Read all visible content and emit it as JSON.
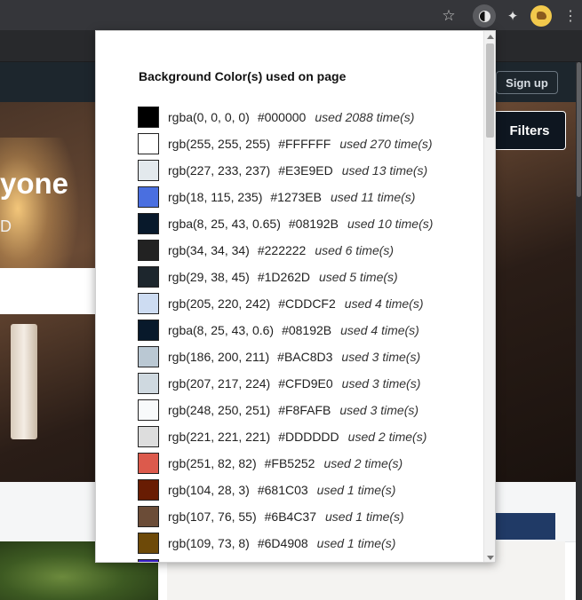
{
  "browser": {
    "toolbar_icons": [
      "star-icon",
      "contrast-icon",
      "puzzle-icon",
      "avatar",
      "kebab-menu-icon"
    ],
    "star_glyph": "☆",
    "puzzle_glyph": "✦",
    "menu_glyph": "⋮"
  },
  "site": {
    "signup_label": "Sign up",
    "filters_label": "Filters",
    "hero_heading": "yone",
    "hero_sub": "D"
  },
  "popup": {
    "title": "Background Color(s) used on page",
    "colors": [
      {
        "rgb": "rgba(0, 0, 0, 0)",
        "hex": "#000000",
        "used": "used 2088 time(s)",
        "swatch": "#000000"
      },
      {
        "rgb": "rgb(255, 255, 255)",
        "hex": "#FFFFFF",
        "used": "used 270 time(s)",
        "swatch": "#FFFFFF"
      },
      {
        "rgb": "rgb(227, 233, 237)",
        "hex": "#E3E9ED",
        "used": "used 13 time(s)",
        "swatch": "#E3E9ED"
      },
      {
        "rgb": "rgb(18, 115, 235)",
        "hex": "#1273EB",
        "used": "used 11 time(s)",
        "swatch": "#4a6fe0"
      },
      {
        "rgb": "rgba(8, 25, 43, 0.65)",
        "hex": "#08192B",
        "used": "used 10 time(s)",
        "swatch": "#08192B"
      },
      {
        "rgb": "rgb(34, 34, 34)",
        "hex": "#222222",
        "used": "used 6 time(s)",
        "swatch": "#222222"
      },
      {
        "rgb": "rgb(29, 38, 45)",
        "hex": "#1D262D",
        "used": "used 5 time(s)",
        "swatch": "#1D262D"
      },
      {
        "rgb": "rgb(205, 220, 242)",
        "hex": "#CDDCF2",
        "used": "used 4 time(s)",
        "swatch": "#CDDCF2"
      },
      {
        "rgb": "rgba(8, 25, 43, 0.6)",
        "hex": "#08192B",
        "used": "used 4 time(s)",
        "swatch": "#08192B"
      },
      {
        "rgb": "rgb(186, 200, 211)",
        "hex": "#BAC8D3",
        "used": "used 3 time(s)",
        "swatch": "#BAC8D3"
      },
      {
        "rgb": "rgb(207, 217, 224)",
        "hex": "#CFD9E0",
        "used": "used 3 time(s)",
        "swatch": "#CFD9E0"
      },
      {
        "rgb": "rgb(248, 250, 251)",
        "hex": "#F8FAFB",
        "used": "used 3 time(s)",
        "swatch": "#F8FAFB"
      },
      {
        "rgb": "rgb(221, 221, 221)",
        "hex": "#DDDDDD",
        "used": "used 2 time(s)",
        "swatch": "#DDDDDD"
      },
      {
        "rgb": "rgb(251, 82, 82)",
        "hex": "#FB5252",
        "used": "used 2 time(s)",
        "swatch": "#dc5a4c"
      },
      {
        "rgb": "rgb(104, 28, 3)",
        "hex": "#681C03",
        "used": "used 1 time(s)",
        "swatch": "#681C03"
      },
      {
        "rgb": "rgb(107, 76, 55)",
        "hex": "#6B4C37",
        "used": "used 1 time(s)",
        "swatch": "#6B4C37"
      },
      {
        "rgb": "rgb(109, 73, 8)",
        "hex": "#6D4908",
        "used": "used 1 time(s)",
        "swatch": "#6D4908"
      },
      {
        "rgb": "",
        "hex": "",
        "used": "",
        "swatch": "#3b22c8"
      }
    ]
  }
}
